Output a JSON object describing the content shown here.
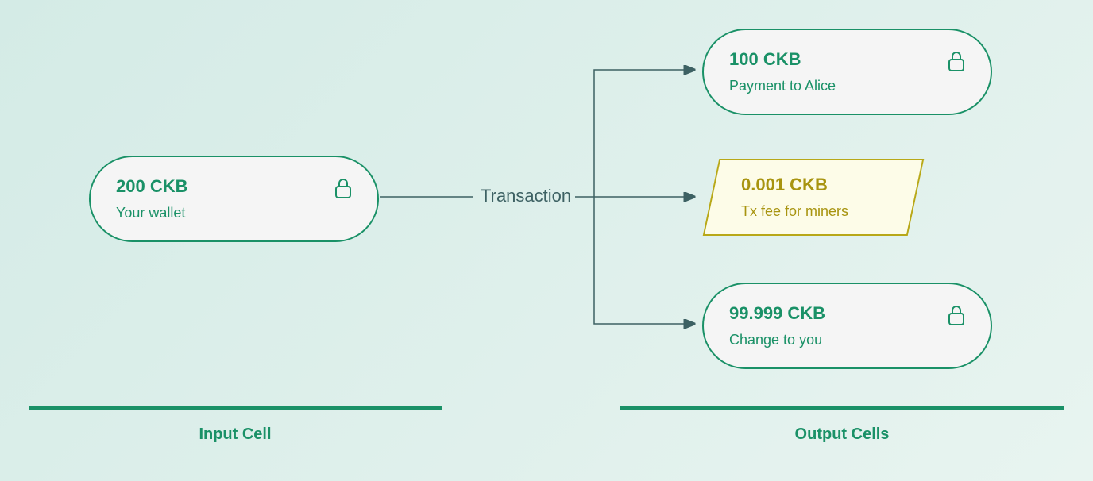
{
  "input": {
    "amount": "200 CKB",
    "description": "Your wallet"
  },
  "outputs": {
    "payment": {
      "amount": "100 CKB",
      "description": "Payment to Alice"
    },
    "fee": {
      "amount": "0.001 CKB",
      "description": "Tx fee for miners"
    },
    "change": {
      "amount": "99.999 CKB",
      "description": "Change to you"
    }
  },
  "labels": {
    "transaction": "Transaction",
    "input_section": "Input Cell",
    "output_section": "Output Cells"
  },
  "colors": {
    "primary": "#1a9167",
    "fee": "#a89410",
    "line": "#3d6163"
  }
}
